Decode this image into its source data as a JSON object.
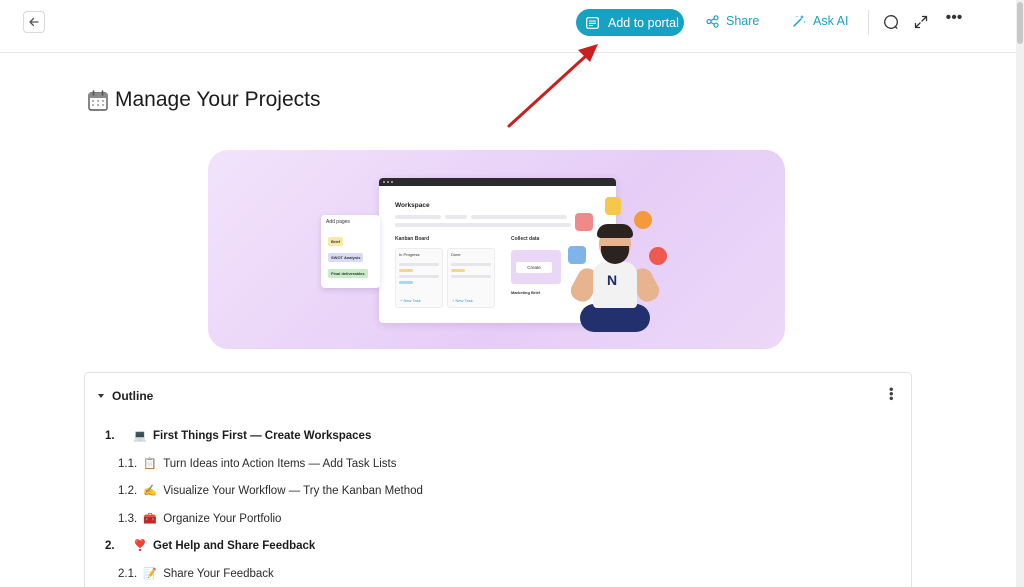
{
  "toolbar": {
    "add_to_portal": "Add to portal",
    "share": "Share",
    "ask_ai": "Ask AI"
  },
  "page": {
    "title": "Manage Your Projects"
  },
  "hero": {
    "add_pages": "Add pages",
    "brief": "Brief",
    "swot": "SWOT Analysis",
    "final": "Final deliverables",
    "workspace": "Workspace",
    "kanban_board": "Kanban Board",
    "in_progress": "In Progress",
    "done": "Done",
    "new_task": "+ New Task",
    "collect_data": "Collect data",
    "create": "Create",
    "marketing_brief": "Marketing Brief",
    "shirt_logo": "N"
  },
  "outline": {
    "heading": "Outline",
    "items": [
      {
        "num": "1.",
        "emoji": "💻",
        "text": "First Things First — Create Workspaces",
        "level": 1
      },
      {
        "num": "1.1.",
        "emoji": "📋",
        "text": "Turn Ideas into Action Items — Add Task Lists",
        "level": 2
      },
      {
        "num": "1.2.",
        "emoji": "✍️",
        "text": "Visualize Your Workflow — Try the Kanban Method",
        "level": 2
      },
      {
        "num": "1.3.",
        "emoji": "🧰",
        "text": "Organize Your Portfolio",
        "level": 2
      },
      {
        "num": "2.",
        "emoji": "❣️",
        "text": "Get Help and Share Feedback",
        "level": 1
      },
      {
        "num": "2.1.",
        "emoji": "📝",
        "text": "Share Your Feedback",
        "level": 2
      }
    ]
  },
  "colors": {
    "accent": "#17a2c3",
    "annotation_arrow": "#c8201f"
  }
}
